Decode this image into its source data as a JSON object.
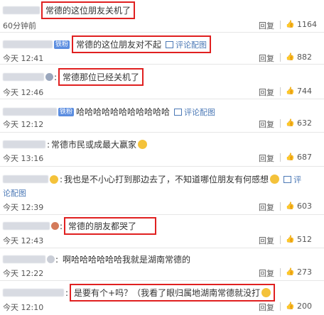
{
  "comments": [
    {
      "text": "常德的这位朋友关机了",
      "time": "60分钟前",
      "reply": "回复",
      "likes": "1164"
    },
    {
      "badge": "铁粉",
      "text": "常德的这位朋友对不起",
      "pic": "评论配图",
      "time": "今天 12:41",
      "reply": "回复",
      "likes": "882"
    },
    {
      "text": "常德那位已经关机了",
      "time": "今天 12:46",
      "reply": "回复",
      "likes": "744"
    },
    {
      "badge": "铁粉",
      "text": "哈哈哈哈哈哈哈哈哈哈哈",
      "pic": "评论配图",
      "time": "今天 12:12",
      "reply": "回复",
      "likes": "632"
    },
    {
      "text": "常德市民或成最大赢家",
      "time": "今天 13:16",
      "reply": "回复",
      "likes": "687"
    },
    {
      "text": "我也是不小心打到那边去了，不知道哪位朋友有何感想",
      "pic_a": "评",
      "pic_b": "论配图",
      "time": "今天 12:39",
      "reply": "回复",
      "likes": "603"
    },
    {
      "text": "常德的朋友都哭了",
      "time": "今天 12:43",
      "reply": "回复",
      "likes": "512"
    },
    {
      "text": "啊哈哈哈哈哈哈我就是湖南常德的",
      "time": "今天 12:22",
      "reply": "回复",
      "likes": "273"
    },
    {
      "text": "是要有个+吗？（我看了眼归属地湖南常德就没打",
      "time": "今天 12:10",
      "reply": "回复",
      "likes": "200"
    }
  ],
  "colors": {
    "highlight": "#e02020",
    "link": "#4c79b6",
    "badge": "#5b8de0"
  }
}
